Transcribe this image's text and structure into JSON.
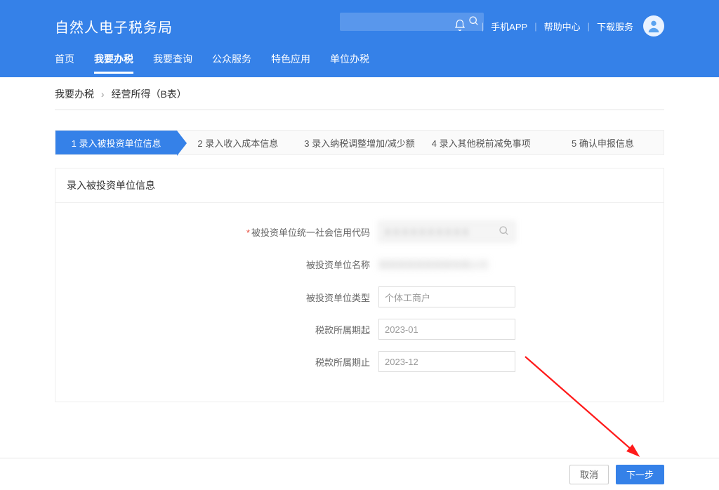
{
  "header": {
    "title": "自然人电子税务局",
    "links": {
      "app": "手机APP",
      "help": "帮助中心",
      "download": "下载服务"
    }
  },
  "nav": {
    "home": "首页",
    "tax": "我要办税",
    "query": "我要查询",
    "public": "公众服务",
    "special": "特色应用",
    "unit": "单位办税"
  },
  "breadcrumb": {
    "root": "我要办税",
    "leaf": "经营所得（B表）"
  },
  "steps": {
    "s1": "1  录入被投资单位信息",
    "s2": "2  录入收入成本信息",
    "s3": "3  录入纳税调整增加/减少额",
    "s4": "4  录入其他税前减免事项",
    "s5": "5  确认申报信息"
  },
  "panel": {
    "title": "录入被投资单位信息"
  },
  "form": {
    "labels": {
      "code": "被投资单位统一社会信用代码",
      "name": "被投资单位名称",
      "type": "被投资单位类型",
      "start": "税款所属期起",
      "end": "税款所属期止"
    },
    "values": {
      "type": "个体工商户",
      "start": "2023-01",
      "end": "2023-12"
    }
  },
  "footer": {
    "cancel": "取消",
    "next": "下一步"
  }
}
